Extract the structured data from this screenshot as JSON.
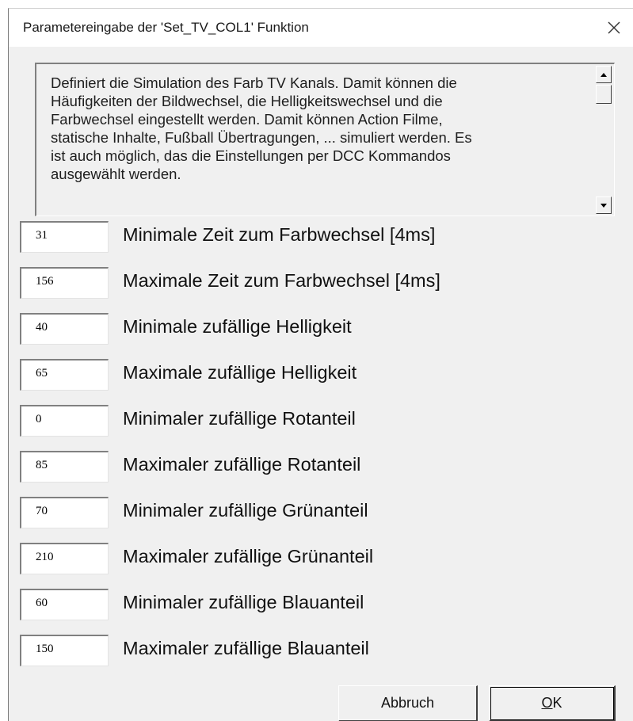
{
  "window": {
    "title": "Parametereingabe der 'Set_TV_COL1' Funktion",
    "close_icon": "close-icon"
  },
  "description": {
    "text": "Definiert die Simulation des Farb TV Kanals. Damit können die\nHäufigkeiten der Bildwechsel, die Helligkeitswechsel und die\nFarbwechsel eingestellt werden. Damit können Action Filme,\nstatische Inhalte, Fußball Übertragungen, ... simuliert werden. Es\nist auch möglich, das die Einstellungen per DCC Kommandos\nausgewählt werden.",
    "scroll_up_icon": "arrow-up-icon",
    "scroll_down_icon": "arrow-down-icon"
  },
  "params": [
    {
      "value": "31",
      "label": "Minimale Zeit zum Farbwechsel [4ms]"
    },
    {
      "value": "156",
      "label": "Maximale Zeit zum Farbwechsel [4ms]"
    },
    {
      "value": "40",
      "label": "Minimale zufällige Helligkeit"
    },
    {
      "value": "65",
      "label": "Maximale zufällige Helligkeit"
    },
    {
      "value": "0",
      "label": "Minimaler zufällige Rotanteil"
    },
    {
      "value": "85",
      "label": "Maximaler zufällige Rotanteil"
    },
    {
      "value": "70",
      "label": "Minimaler zufällige Grünanteil"
    },
    {
      "value": "210",
      "label": "Maximaler zufällige Grünanteil"
    },
    {
      "value": "60",
      "label": "Minimaler zufällige Blauanteil"
    },
    {
      "value": "150",
      "label": "Maximaler zufällige Blauanteil"
    }
  ],
  "buttons": {
    "cancel_label": "Abbruch",
    "ok_mnemonic": "O",
    "ok_rest": "K"
  },
  "colors": {
    "dialog_bg": "#f0f0f0",
    "titlebar_bg": "#ffffff",
    "input_bg": "#ffffff"
  }
}
